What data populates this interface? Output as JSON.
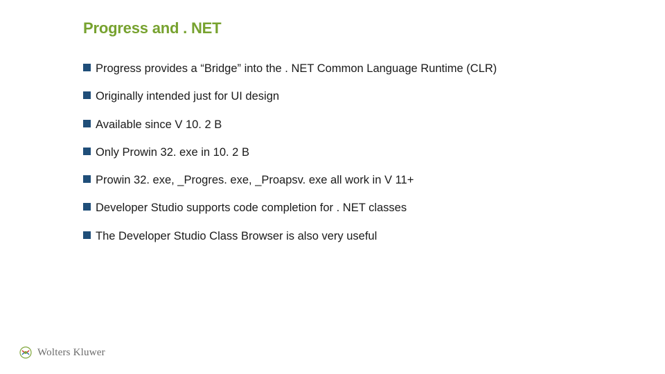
{
  "slide": {
    "title": "Progress and . NET",
    "bullets": [
      "Progress provides a “Bridge” into the . NET Common Language Runtime (CLR)",
      "Originally intended just for UI design",
      "Available since V 10. 2 B",
      "Only Prowin 32. exe in 10. 2 B",
      "Prowin 32. exe, _Progres. exe, _Proapsv. exe all  work in V 11+",
      "Developer Studio supports code completion for . NET classes",
      "The Developer Studio Class Browser is also very useful"
    ]
  },
  "footer": {
    "brand": "Wolters Kluwer"
  }
}
